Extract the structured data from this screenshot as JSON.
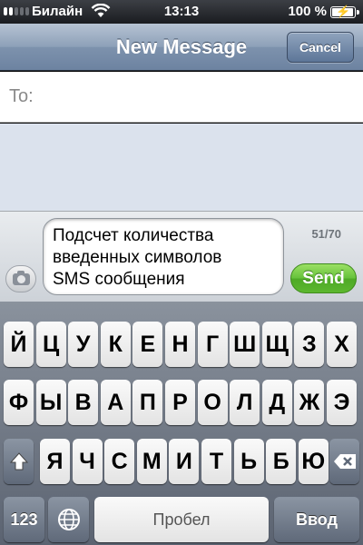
{
  "status_bar": {
    "carrier": "Билайн",
    "time": "13:13",
    "battery_percent": "100 %",
    "battery_level": 1.0
  },
  "nav": {
    "title": "New Message",
    "cancel_label": "Cancel"
  },
  "recipient": {
    "label": "To:"
  },
  "compose": {
    "message_text": "Подсчет количества\nвведенных символов\nSMS сообщения",
    "char_count": "51/70",
    "send_label": "Send"
  },
  "keyboard": {
    "row1": [
      "Й",
      "Ц",
      "У",
      "К",
      "Е",
      "Н",
      "Г",
      "Ш",
      "Щ",
      "З",
      "Х"
    ],
    "row2": [
      "Ф",
      "Ы",
      "В",
      "А",
      "П",
      "Р",
      "О",
      "Л",
      "Д",
      "Ж",
      "Э"
    ],
    "row3": [
      "Я",
      "Ч",
      "С",
      "М",
      "И",
      "Т",
      "Ь",
      "Б",
      "Ю"
    ],
    "numbers_label": "123",
    "space_label": "Пробел",
    "enter_label": "Ввод"
  },
  "icons": {
    "shift": "shift-icon",
    "backspace": "backspace-icon",
    "globe": "globe-icon",
    "camera": "camera-icon",
    "wifi": "wifi-icon",
    "battery": "battery-icon"
  },
  "colors": {
    "nav_bar": "#7d92ad",
    "send_button": "#5cb72f",
    "thread_background": "#dbe2ed"
  }
}
